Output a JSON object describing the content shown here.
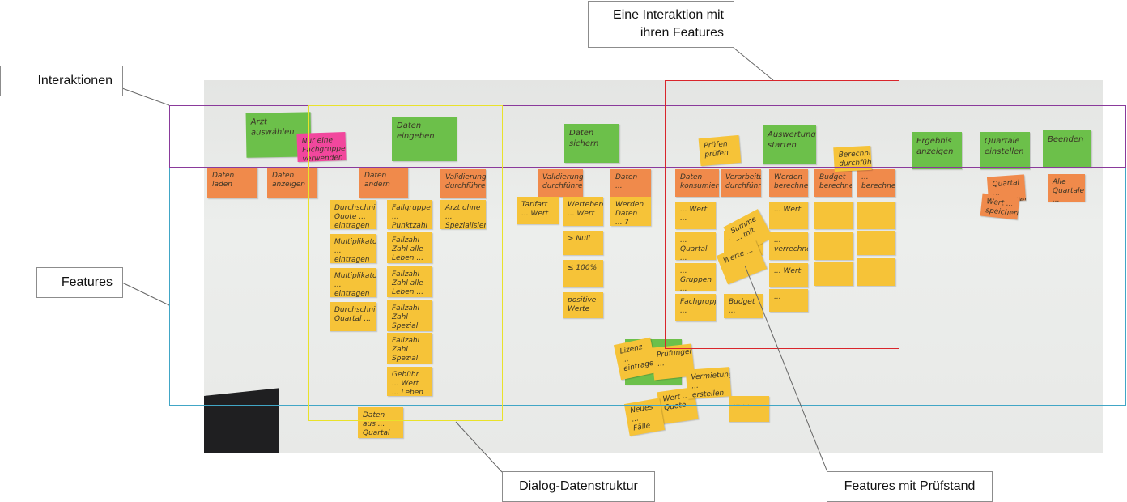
{
  "callouts": {
    "interaktionen": "Interaktionen",
    "features": "Features",
    "eine_interaktion": "Eine Interaktion mit\nihren Features",
    "dialog": "Dialog-Datenstruktur",
    "pruefstand": "Features mit Prüfstand"
  },
  "colors": {
    "purple_box": "#8a3a9b",
    "cyan_box": "#41a6c6",
    "yellow_box": "#e9e22a",
    "red_box": "#d9252b",
    "green_note": "#6cc04a",
    "orange_note": "#f08a4b",
    "yellow_note": "#f6c338",
    "pink_note": "#f2479d"
  },
  "notes": {
    "arzt": "Arzt auswählen",
    "pink": "Nur eine Fachgruppe verwenden",
    "daten_eingeben": "Daten eingeben",
    "daten_sichern": "Daten sichern",
    "auswertung": "Auswertung starten",
    "ergebnis": "Ergebnis anzeigen",
    "quartale": "Quartale einstellen",
    "beenden": "Beenden",
    "daten_laden": "Daten laden",
    "daten_anzeigen": "Daten anzeigen",
    "daten_aendern": "Daten ändern",
    "validierung": "Validierung durchführen",
    "validierung2": "Validierung durchführen",
    "daten_a": "Daten ...",
    "daten_konsum": "Daten konsumieren",
    "verarbeitung": "Verarbeitung durchführen",
    "werden_berechnen": "Werden berechnen",
    "budget": "Budget berechnen",
    "fachbudget": "... berechnen",
    "pruefen": "Prüfen prüfen",
    "berechnung": "Berechnung durchführen",
    "y_durchschnitt": "Durchschnitts Quote ... eintragen",
    "y_fallgruppe": "Fallgruppe ... Punktzahl",
    "y_arzt_ohne": "Arzt ohne ... Spezialisierung",
    "y_tarifart": "Tarifart ... Wert",
    "y_wertebereich": "Wertebereich ... Wert",
    "y_werden_daten": "Werden Daten ... ?",
    "y_multiplikator": "Multiplikator ... eintragen",
    "y_fallzahl1": "Fallzahl Zahl alle Leben ... MF",
    "y_null": "> Null",
    "y_multiplik2": "Multiplikator ... eintragen",
    "y_fallzahl2": "Fallzahl Zahl alle Leben ... R",
    "y_100": "≤ 100%",
    "y_positive": "positive Werte",
    "y_quartal": "Durchschnitt Quartal ...",
    "y_fallzahl3": "Fallzahl Zahl Spezial Leben ... M",
    "y_fallzahl4": "Fallzahl Zahl Spezial Leben ... R",
    "y_gebuehr": "Gebühr ... Wert ... Leben",
    "y_daten_gross": "Daten aus ... Quartal",
    "y_r1": "... Wert ...",
    "y_r2": "... Quartal ...",
    "y_r3": "... Gruppen ...",
    "y_r4": "Fachgruppe ...",
    "y_r5": "... Wert",
    "y_r6": "Summe ... mit ...",
    "y_r7": "Werte ...",
    "y_r8": "Budget ...",
    "y_r9": "... Wert",
    "y_r10": "... verrechnen",
    "y_r11": "... Wert",
    "y_r12": "...",
    "y_cl1": "Lizenz ... eintragen",
    "y_cl2": "Prüfungen ...",
    "y_cl3": "Wert ... Quote",
    "y_cl4": "Vermietung ... erstellen",
    "y_cl5": "Neues ... Fälle",
    "y_cl6": "... ...",
    "or_right1": "Quartal ... einstellen",
    "or_right2": "Alle Quartale ...",
    "or_right3": "Wert ... speichern"
  }
}
